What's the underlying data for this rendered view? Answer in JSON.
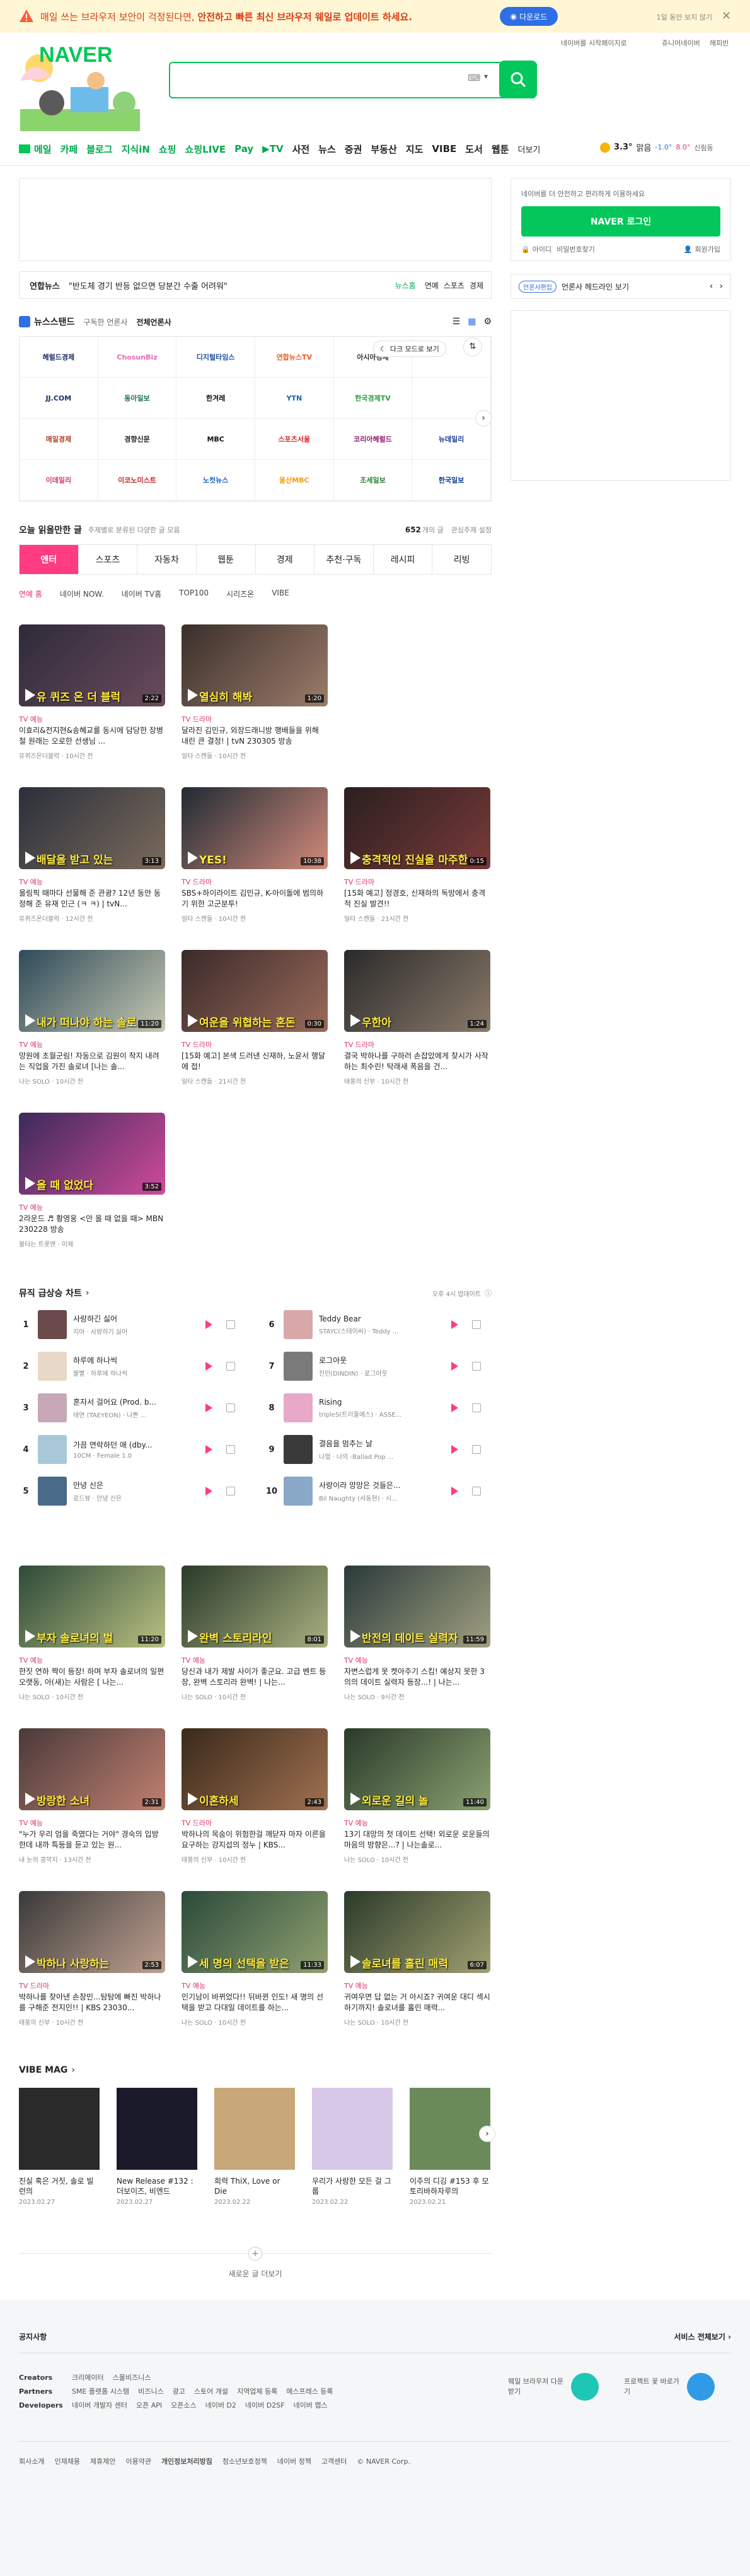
{
  "topbar": {
    "message_pre": "매일 쓰는 브라우저 보안이 걱정된다면, ",
    "message_bold": "안전하고 빠른 최신 브라우저 웨일로 업데이트 하세요.",
    "download": "다운로드",
    "later": "1일 동안 보지 않기"
  },
  "util": {
    "start": "네이버를 시작페이지로",
    "jr": "쥬니어네이버",
    "happy": "해피빈"
  },
  "logo": {
    "text": "NAVER"
  },
  "search": {
    "value": "",
    "hangul": "한",
    "keyboard": "⌨"
  },
  "gnb": {
    "items": [
      "메일",
      "카페",
      "블로그",
      "지식iN",
      "쇼핑",
      "쇼핑LIVE",
      "Pay",
      "▶TV",
      "사전",
      "뉴스",
      "증권",
      "부동산",
      "지도",
      "VIBE",
      "도서",
      "웹툰"
    ],
    "more": "더보기"
  },
  "weather": {
    "temp": "3.3°",
    "desc": "맑음",
    "min": "-1.0°",
    "max": "8.0°",
    "place": "신림동"
  },
  "newsbar": {
    "source": "연합뉴스",
    "text": "\"반도체 경기 반등 없으면 당분간 수출 어려워\"",
    "tag": "뉴스홈",
    "links": [
      "연예",
      "스포츠",
      "경제"
    ]
  },
  "newsstand": {
    "title": "뉴스스탠드",
    "sub1": "구독한 언론사",
    "sub2": "전체언론사",
    "darkmode": "다크 모드로 보기",
    "press": [
      "헤럴드경제",
      "ChosunBiz",
      "디지털타임스",
      "연합뉴스TV",
      "아시아경제",
      "",
      "JJ.COM",
      "동아일보",
      "한겨레",
      "YTN",
      "한국경제TV",
      "",
      "매일경제",
      "경향신문",
      "MBC",
      "스포츠서울",
      "코리아헤럴드",
      "뉴데일리",
      "이데일리",
      "이코노미스트",
      "노컷뉴스",
      "울산MBC",
      "조세일보",
      "한국일보"
    ]
  },
  "today": {
    "title": "오늘 읽을만한 글",
    "sub": "주제별로 분류된 다양한 글 모음",
    "count": "652",
    "count_label": "개의 글",
    "setting": "관심주제 설정",
    "tabs": [
      "엔터",
      "스포츠",
      "자동차",
      "웹툰",
      "경제",
      "추천·구독",
      "레시피",
      "리빙"
    ],
    "subtabs": [
      "연예 홈",
      "네이버 NOW.",
      "네이버 TV홈",
      "TOP100",
      "시리즈온",
      "VIBE"
    ]
  },
  "videos": [
    {
      "cat": "TV 예능",
      "title": "이효리&전지현&송혜교를 동시에 담당한 장병철 원래는 오로한 선생님 ...",
      "src": "유퀴즈온더블럭 · 10시간 전",
      "dur": "2:22",
      "cap": "유 퀴즈 온 더 블럭"
    },
    {
      "cat": "TV 드라마",
      "title": "달라진 김민규, 외장드래니방 행배들을 위해 내린 큰 결정! | tvN 230305 방송",
      "src": "일타 스캔들 · 10시간 전",
      "dur": "1:20",
      "cap": "열심히 해봐"
    },
    {
      "cat": "TV 예능",
      "title": "올림픽 때마다 선물해 준 관광? 12년 동안 동정해 준 유재 인근 (ㅋ ㅋ) | tvN...",
      "src": "유퀴즈온더블럭 · 12시간 전",
      "dur": "3:13",
      "cap": "배달을 받고 있는"
    },
    {
      "cat": "TV 드라마",
      "title": "SBS+하이라이트 김민규, K-아이돌에 범의하기 위한 고군분투!",
      "src": "일타 스캔들 · 10시간 전",
      "dur": "10:38",
      "cap": "YES!"
    },
    {
      "cat": "TV 드라마",
      "title": "[15화 예고] 정경호, 신재하의 독방에서 충격적 진실 발견!!",
      "src": "일타 스캔들 · 21시간 전",
      "dur": "0:15",
      "cap": "충격적인 진실을 마주한"
    },
    {
      "cat": "TV 예능",
      "title": "망원에 초월군림! 자동으로 김원이 착지 내려는 직업을 가진 솔로녀 [나는 솔...",
      "src": "나는 SOLO · 10시간 전",
      "dur": "11:20",
      "cap": "내가 떠나야 하는 솔로"
    },
    {
      "cat": "TV 드라마",
      "title": "[15화 예고] 본색 드러낸 신재하, 노윤서 행달에 접!",
      "src": "일타 스캔들 · 21시간 전",
      "dur": "0:30",
      "cap": "여운을 위협하는 혼돈"
    },
    {
      "cat": "TV 드라마",
      "title": "결국 박하나를 구하러 손잡았에게 찾시가 사작하는 최수린! 탁래새 폭음을 건...",
      "src": "태풍의 신부 · 10시간 전",
      "dur": "1:24",
      "cap": "우한아"
    },
    {
      "cat": "TV 예능",
      "title": "2라운드 ♬ 황영웅 <안 올 때 없을 때> MBN 230228 방송",
      "src": "불타는 트롯맨 · 이제",
      "dur": "3:52",
      "cap": "올 때 없었다"
    },
    {
      "cat": "TV 예능",
      "title": "한짓 연하 짝이 등장! 하며 부자 솔로녀의 일편 오랫동, 아(새)는 사람은 [ 나는...",
      "src": "나는 SOLO · 10시간 전",
      "dur": "11:20",
      "cap": "부자 솔로녀의 벌"
    },
    {
      "cat": "TV 예능",
      "title": "당신과 내가 제발 사이가 좋군요. 고급 벤트 등장, 완벽 스토리라 완벽! | 나는...",
      "src": "나는 SOLO · 10시간 전",
      "dur": "8:01",
      "cap": "완벽 스토리라인"
    },
    {
      "cat": "TV 예능",
      "title": "자변스럽게 못 켓아주기 스킴! 예상지 못한 3의의 데이트 실력자 등장...! | 나는...",
      "src": "나는 SOLO · 9시간 전",
      "dur": "11:59",
      "cap": "반전의 데이트 실력자"
    },
    {
      "cat": "TV 예능",
      "title": "\"누가 우리 엄을 죽였다는 거야\" 경숙의 입방한데 내까 특등을 듣고 있는 원...",
      "src": "내 눈의 콩깍지 · 13시간 전",
      "dur": "2:31",
      "cap": "방랑한 소녀"
    },
    {
      "cat": "TV 드라마",
      "title": "박하나의 목숨이 위험한걸 깨닫자 마자 이른을 요구하는 강지섭의 정누 | KBS...",
      "src": "태풍의 신부 · 10시간 전",
      "dur": "2:43",
      "cap": "이혼하세"
    },
    {
      "cat": "TV 예능",
      "title": "13기 대망의 첫 데이트 선택! 외로운 로운들의 마음의 방향은...? | 나는솔로...",
      "src": "나는 SOLO · 10시간 전",
      "dur": "11:40",
      "cap": "외로운 길의 놀"
    },
    {
      "cat": "TV 드라마",
      "title": "박하나를 찾아낸 손창민...탐탐에 빠진 박하나를 구해준 전지인!! | KBS 23030...",
      "src": "태풍의 신부 · 10시간 전",
      "dur": "2:53",
      "cap": "박하나 사랑하는"
    },
    {
      "cat": "TV 예능",
      "title": "인기남이 바뀌었다!! 뒤바뀐 인도! 새 명의 선택을 받고 다대일 데이트를 하는...",
      "src": "나는 SOLO · 10시간 전",
      "dur": "11:33",
      "cap": "세 명의 선택을 받은"
    },
    {
      "cat": "TV 예능",
      "title": "귀여우면 답 없는 거 아시죠? 귀여운 대디 섹시하기까지! 솔로녀를 홀린 매력...",
      "src": "나는 SOLO · 10시간 전",
      "dur": "6:07",
      "cap": "솔로녀를 홀린 매력"
    }
  ],
  "music": {
    "title": "뮤직 급상승 차트",
    "updated": "오후 4시 업데이트",
    "tracks": [
      {
        "rank": "1",
        "title": "사랑하긴 싫어",
        "artist": "지아 · 사랑하기 싫어"
      },
      {
        "rank": "2",
        "title": "하루에 하나씩",
        "artist": "볼빨 · 하루에 하나씩"
      },
      {
        "rank": "3",
        "title": "혼자서 걸어요 (Prod. b...",
        "artist": "태연 (TAEYEON) · 나쁜 ..."
      },
      {
        "rank": "4",
        "title": "가끔 연락하던 애 (dby...",
        "artist": "10CM · Female 1.0"
      },
      {
        "rank": "5",
        "title": "안녕 신은",
        "artist": "로드뷰 · 안녕 신은"
      },
      {
        "rank": "6",
        "title": "Teddy Bear",
        "artist": "STAYC(스테이씨) · Teddy ..."
      },
      {
        "rank": "7",
        "title": "로그아웃",
        "artist": "진민(DINDIN) · 로그아웃"
      },
      {
        "rank": "8",
        "title": "Rising",
        "artist": "tripleS(트리플에스) · ASSE..."
      },
      {
        "rank": "9",
        "title": "결음을 멈추는 날",
        "artist": "나얼 · 나의 -Ballad Pop ..."
      },
      {
        "rank": "10",
        "title": "사랑이라 망망은 것들은...",
        "artist": "Bil Naughty (서동현) · 시..."
      }
    ]
  },
  "vibemag": {
    "title": "VIBE MAG",
    "items": [
      {
        "title": "진실 혹은 거짓, 솔로 빌런의",
        "date": "2023.02.27"
      },
      {
        "title": "New Release #132 : 더보이즈, 비엔드",
        "date": "2023.02.27"
      },
      {
        "title": "희력 ThiX, Love or Die",
        "date": "2023.02.22"
      },
      {
        "title": "우리가 사랑한 모든 걸 그룹",
        "date": "2023.02.22"
      },
      {
        "title": "이주의 디깅 #153 후 모토리바하자루의",
        "date": "2023.02.21"
      }
    ]
  },
  "more": "새로운 글 더보기",
  "login": {
    "notice": "네이버를 더 안전하고 편리하게 이용하세요",
    "button": "NAVER 로그인",
    "find_id": "아이디",
    "find_pw": "비밀번호찾기",
    "join": "회원가입"
  },
  "sidebar_news": {
    "badge": "언론사편집",
    "label": "언론사 헤드라인 보기"
  },
  "footer": {
    "notice": "공지사항",
    "service_all": "서비스 전체보기",
    "rows": [
      {
        "label": "Creators",
        "links": [
          "크리에이터",
          "스몰비즈니스"
        ]
      },
      {
        "label": "Partners",
        "links": [
          "SME 플랫폼 시스템",
          "비즈니스",
          "광고",
          "스토어 개설",
          "지역업체 등록",
          "에스프레스 등록"
        ]
      },
      {
        "label": "Developers",
        "links": [
          "네이버 개발자 센터",
          "오픈 API",
          "오픈소스",
          "네이버 D2",
          "네이버 D2SF",
          "네이버 랩스"
        ]
      }
    ],
    "whale": "웨일 브라우저 다운받기",
    "protect": "프로젝트 꽃 바로가기",
    "bottom": [
      "회사소개",
      "인재채용",
      "제휴제안",
      "이용약관",
      "개인정보처리방침",
      "청소년보호정책",
      "네이버 정책",
      "고객센터",
      "© NAVER Corp."
    ]
  }
}
